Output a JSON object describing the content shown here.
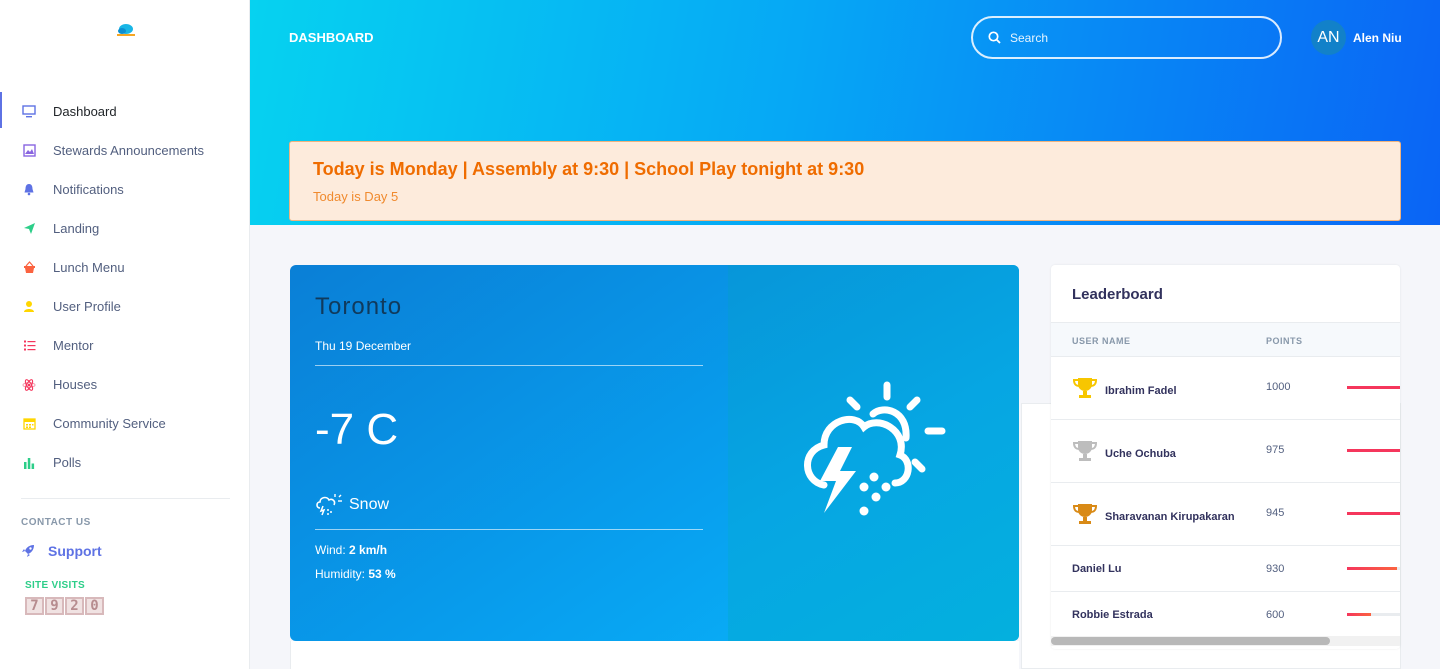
{
  "sidebar": {
    "items": [
      {
        "label": "Dashboard",
        "icon": "monitor-icon",
        "color": "#5e72e4"
      },
      {
        "label": "Stewards Announcements",
        "icon": "image-icon",
        "color": "#8965e0"
      },
      {
        "label": "Notifications",
        "icon": "bell-icon",
        "color": "#5e72e4"
      },
      {
        "label": "Landing",
        "icon": "send-icon",
        "color": "#2dce89"
      },
      {
        "label": "Lunch Menu",
        "icon": "basket-icon",
        "color": "#fb6340"
      },
      {
        "label": "User Profile",
        "icon": "user-icon",
        "color": "#ffd600"
      },
      {
        "label": "Mentor",
        "icon": "list-icon",
        "color": "#f5365c"
      },
      {
        "label": "Houses",
        "icon": "atom-icon",
        "color": "#f3a4b5"
      },
      {
        "label": "Community Service",
        "icon": "calendar-icon",
        "color": "#ffd600"
      },
      {
        "label": "Polls",
        "icon": "bar-chart-icon",
        "color": "#2dce89"
      }
    ],
    "contact_heading": "CONTACT US",
    "support_label": "Support",
    "visits_label": "SITE VISITS",
    "visits_digits": [
      "7",
      "9",
      "2",
      "0"
    ]
  },
  "header": {
    "title": "DASHBOARD",
    "search_placeholder": "Search",
    "user_initials": "AN",
    "user_name": "Alen Niu"
  },
  "announcement": {
    "title": "Today is Monday | Assembly at 9:30 | School Play tonight at 9:30",
    "subtitle": "Today is Day 5"
  },
  "weather": {
    "city": "Toronto",
    "date": "Thu 19 December",
    "temperature": "-7 C",
    "condition": "Snow",
    "wind_label": "Wind: ",
    "wind_value": "2 km/h",
    "humidity_label": "Humidity: ",
    "humidity_value": "53 %"
  },
  "leaderboard": {
    "title": "Leaderboard",
    "col_user": "USER NAME",
    "col_points": "POINTS",
    "rows": [
      {
        "name": "Ibrahim Fadel",
        "points": "1000",
        "trophy": "gold",
        "progress": 1.0
      },
      {
        "name": "Uche Ochuba",
        "points": "975",
        "trophy": "silver",
        "progress": 0.975
      },
      {
        "name": "Sharavanan Kirupakaran",
        "points": "945",
        "trophy": "bronze",
        "progress": 0.945
      },
      {
        "name": "Daniel Lu",
        "points": "930",
        "trophy": "",
        "progress": 0.83
      },
      {
        "name": "Robbie Estrada",
        "points": "600",
        "trophy": "",
        "progress": 0.4
      }
    ]
  },
  "colors": {
    "accent": "#5e72e4",
    "announce_text": "#ef6c00",
    "gold": "#f7c600",
    "silver": "#bdbdbd",
    "bronze": "#d98a16"
  }
}
